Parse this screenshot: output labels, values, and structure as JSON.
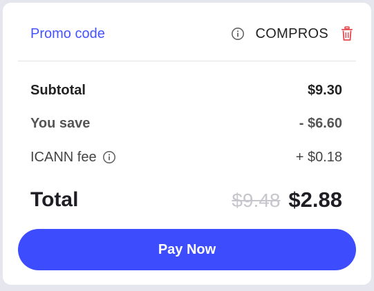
{
  "promo": {
    "link_label": "Promo code",
    "info_icon": "info-icon",
    "code": "COMPROS",
    "remove_icon": "trash-icon"
  },
  "summary": {
    "subtotal_label": "Subtotal",
    "subtotal_value": "$9.30",
    "save_label": "You save",
    "save_value": "- $6.60",
    "icann_label": "ICANN fee",
    "icann_info_icon": "info-icon",
    "icann_value": "+ $0.18"
  },
  "total": {
    "label": "Total",
    "original": "$9.48",
    "final": "$2.88"
  },
  "pay_button": {
    "label": "Pay Now"
  },
  "colors": {
    "accent": "#3d4dfd",
    "link": "#4353ff",
    "remove": "#e5484d",
    "strikethrough": "#c6c6cc"
  }
}
